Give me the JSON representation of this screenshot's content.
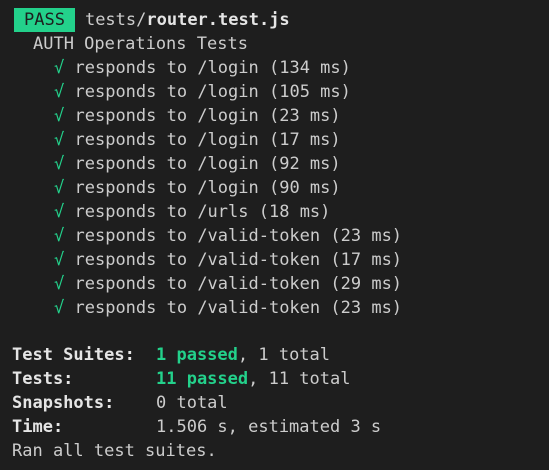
{
  "header": {
    "badge": "PASS",
    "path_dir": "tests/",
    "path_file": "router.test.js"
  },
  "suite_name": "AUTH Operations Tests",
  "check_glyph": "√",
  "tests": [
    {
      "name": "responds to /login",
      "duration": "(134 ms)"
    },
    {
      "name": "responds to /login",
      "duration": "(105 ms)"
    },
    {
      "name": "responds to /login",
      "duration": "(23 ms)"
    },
    {
      "name": "responds to /login",
      "duration": "(17 ms)"
    },
    {
      "name": "responds to /login",
      "duration": "(92 ms)"
    },
    {
      "name": "responds to /login",
      "duration": "(90 ms)"
    },
    {
      "name": "responds to /urls",
      "duration": "(18 ms)"
    },
    {
      "name": "responds to /valid-token",
      "duration": "(23 ms)"
    },
    {
      "name": "responds to /valid-token",
      "duration": "(17 ms)"
    },
    {
      "name": "responds to /valid-token",
      "duration": "(29 ms)"
    },
    {
      "name": "responds to /valid-token",
      "duration": "(23 ms)"
    }
  ],
  "summary": {
    "suites_label": "Test Suites:",
    "suites_passed": "1 passed",
    "suites_total": ", 1 total",
    "tests_label": "Tests:",
    "tests_passed": "11 passed",
    "tests_total": ", 11 total",
    "snapshots_label": "Snapshots:",
    "snapshots_value": "0 total",
    "time_label": "Time:",
    "time_value": "1.506 s, estimated 3 s",
    "ran_all": "Ran all test suites."
  },
  "colors": {
    "background": "#1e1e1e",
    "pass": "#23d18b",
    "text": "#cccccc"
  }
}
